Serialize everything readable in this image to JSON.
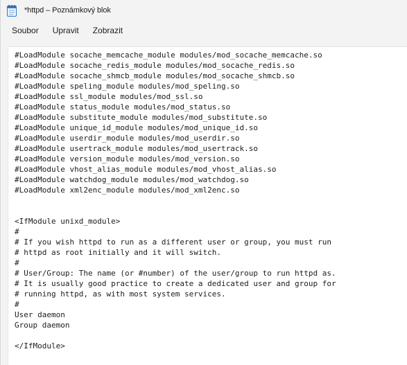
{
  "window": {
    "title": "*httpd – Poznámkový blok",
    "app_icon": "notepad-icon"
  },
  "menu": {
    "items": [
      "Soubor",
      "Upravit",
      "Zobrazit"
    ]
  },
  "editor": {
    "lines": [
      "#LoadModule socache_memcache_module modules/mod_socache_memcache.so",
      "#LoadModule socache_redis_module modules/mod_socache_redis.so",
      "#LoadModule socache_shmcb_module modules/mod_socache_shmcb.so",
      "#LoadModule speling_module modules/mod_speling.so",
      "#LoadModule ssl_module modules/mod_ssl.so",
      "#LoadModule status_module modules/mod_status.so",
      "#LoadModule substitute_module modules/mod_substitute.so",
      "#LoadModule unique_id_module modules/mod_unique_id.so",
      "#LoadModule userdir_module modules/mod_userdir.so",
      "#LoadModule usertrack_module modules/mod_usertrack.so",
      "#LoadModule version_module modules/mod_version.so",
      "#LoadModule vhost_alias_module modules/mod_vhost_alias.so",
      "#LoadModule watchdog_module modules/mod_watchdog.so",
      "#LoadModule xml2enc_module modules/mod_xml2enc.so",
      "",
      "",
      "<IfModule unixd_module>",
      "#",
      "# If you wish httpd to run as a different user or group, you must run",
      "# httpd as root initially and it will switch.",
      "#",
      "# User/Group: The name (or #number) of the user/group to run httpd as.",
      "# It is usually good practice to create a dedicated user and group for",
      "# running httpd, as with most system services.",
      "#",
      "User daemon",
      "Group daemon",
      "",
      "</IfModule>"
    ]
  }
}
